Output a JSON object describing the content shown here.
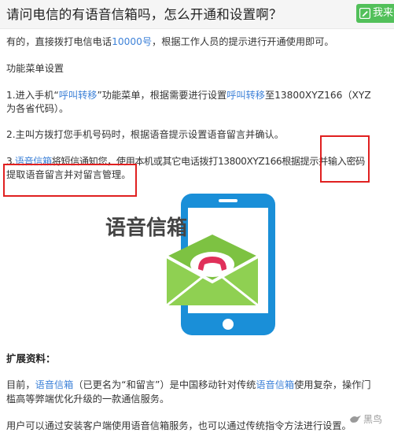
{
  "header": {
    "title": "请问电信的有语音信箱吗，怎么开通和设置啊？",
    "answer_button_label": "我来答"
  },
  "answer": {
    "intro": {
      "before": "有的，直接拨打电信电话",
      "link": "10000号",
      "after": "，根据工作人员的提示进行开通使用即可。"
    },
    "menu_title": "功能菜单设置",
    "step1": {
      "l1_a": "1.进入手机“",
      "l1_link1": "呼叫转移",
      "l1_b": "”功能菜单，根据需要进行设置",
      "l1_link2": "呼叫转移",
      "l1_c": "至13800XYZ166（XYZ",
      "l2": "为各省代码）。"
    },
    "step2": "2.主叫方拨打您手机号码时，根据语音提示设置语音留言并确认。",
    "step3": {
      "prefix": "3.",
      "link": "语音信箱",
      "l1_rest": "将短信通知您，使用本机或其它电话拨打13800XYZ166根据提示并输入密码",
      "l2": "提取语音留言并对留言管理。"
    },
    "illustration_label": "语音信箱",
    "extended_heading": "扩展资料：",
    "extended": {
      "l1_a": "目前，",
      "l1_link1": "语音信箱",
      "l1_b": "（已更名为“和留言”）是中国移动针对传统",
      "l1_link2": "语音信箱",
      "l1_c": "使用复杂，操作门",
      "l2": "槛高等弊端优化升级的一款通信服务。",
      "l3": "用户可以通过安装客户端使用语音信箱服务，也可以通过传统指令方法进行设置。"
    }
  },
  "watermark": "黑鸟",
  "colors": {
    "link": "#3e82d8",
    "highlight_box": "#e02020",
    "answer_button": "#52c05a",
    "phone_frame": "#1a8fd8",
    "envelope": "#7dc242",
    "handset": "#e0305a"
  },
  "icons": [
    "edit-icon",
    "voicemail-phone-envelope-icon",
    "bird-logo-icon"
  ]
}
